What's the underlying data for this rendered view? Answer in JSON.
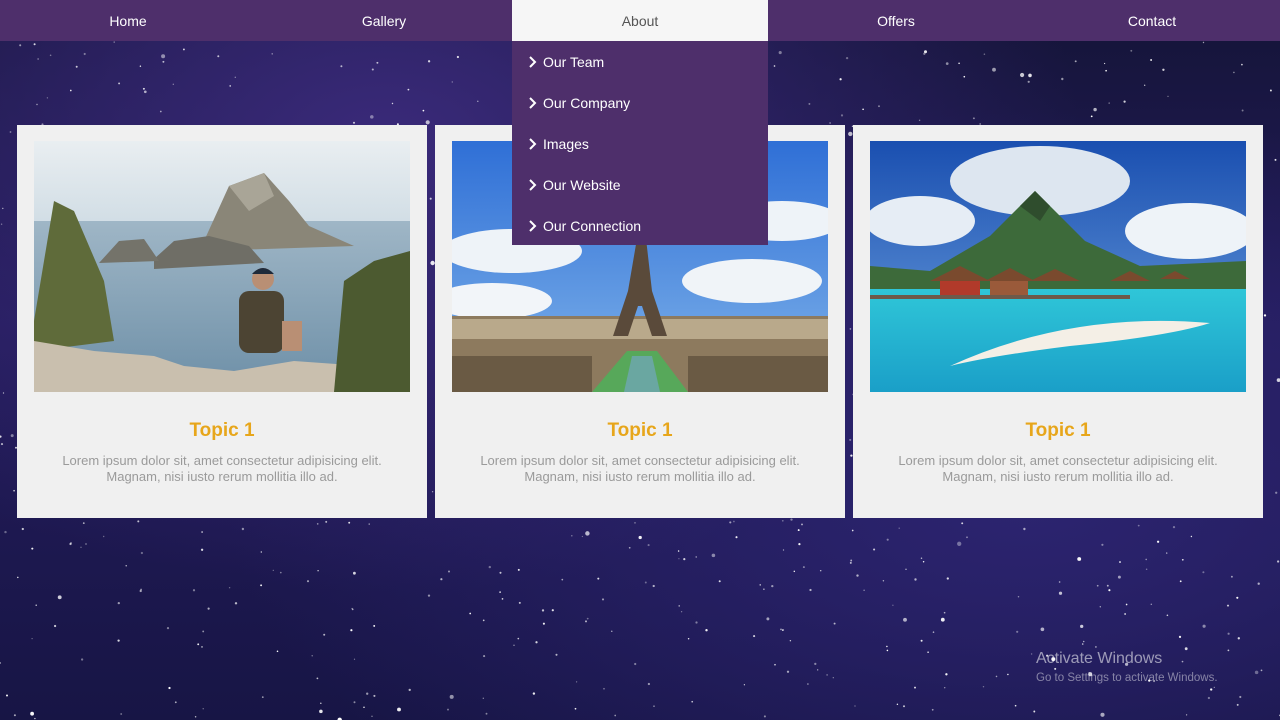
{
  "nav": {
    "items": [
      {
        "label": "Home"
      },
      {
        "label": "Gallery"
      },
      {
        "label": "About"
      },
      {
        "label": "Offers"
      },
      {
        "label": "Contact"
      }
    ],
    "active": "About"
  },
  "dropdown": {
    "items": [
      {
        "label": "Our Team"
      },
      {
        "label": "Our Company"
      },
      {
        "label": "Images"
      },
      {
        "label": "Our Website"
      },
      {
        "label": "Our Connection"
      }
    ]
  },
  "cards": [
    {
      "title": "Topic 1",
      "text": "Lorem ipsum dolor sit, amet consectetur adipisicing elit. Magnam, nisi iusto rerum mollitia illo ad.",
      "image": "coastal-cliff-photo"
    },
    {
      "title": "Topic 1",
      "text": "Lorem ipsum dolor sit, amet consectetur adipisicing elit. Magnam, nisi iusto rerum mollitia illo ad.",
      "image": "eiffel-tower-photo"
    },
    {
      "title": "Topic 1",
      "text": "Lorem ipsum dolor sit, amet consectetur adipisicing elit. Magnam, nisi iusto rerum mollitia illo ad.",
      "image": "tropical-island-photo"
    }
  ],
  "watermark": {
    "title": "Activate Windows",
    "subtitle": "Go to Settings to activate Windows."
  },
  "colors": {
    "nav_bg": "#4e2f6b",
    "active_bg": "#f6f6f6",
    "title_accent": "#e7a61b",
    "card_bg": "#f0f0f0"
  }
}
